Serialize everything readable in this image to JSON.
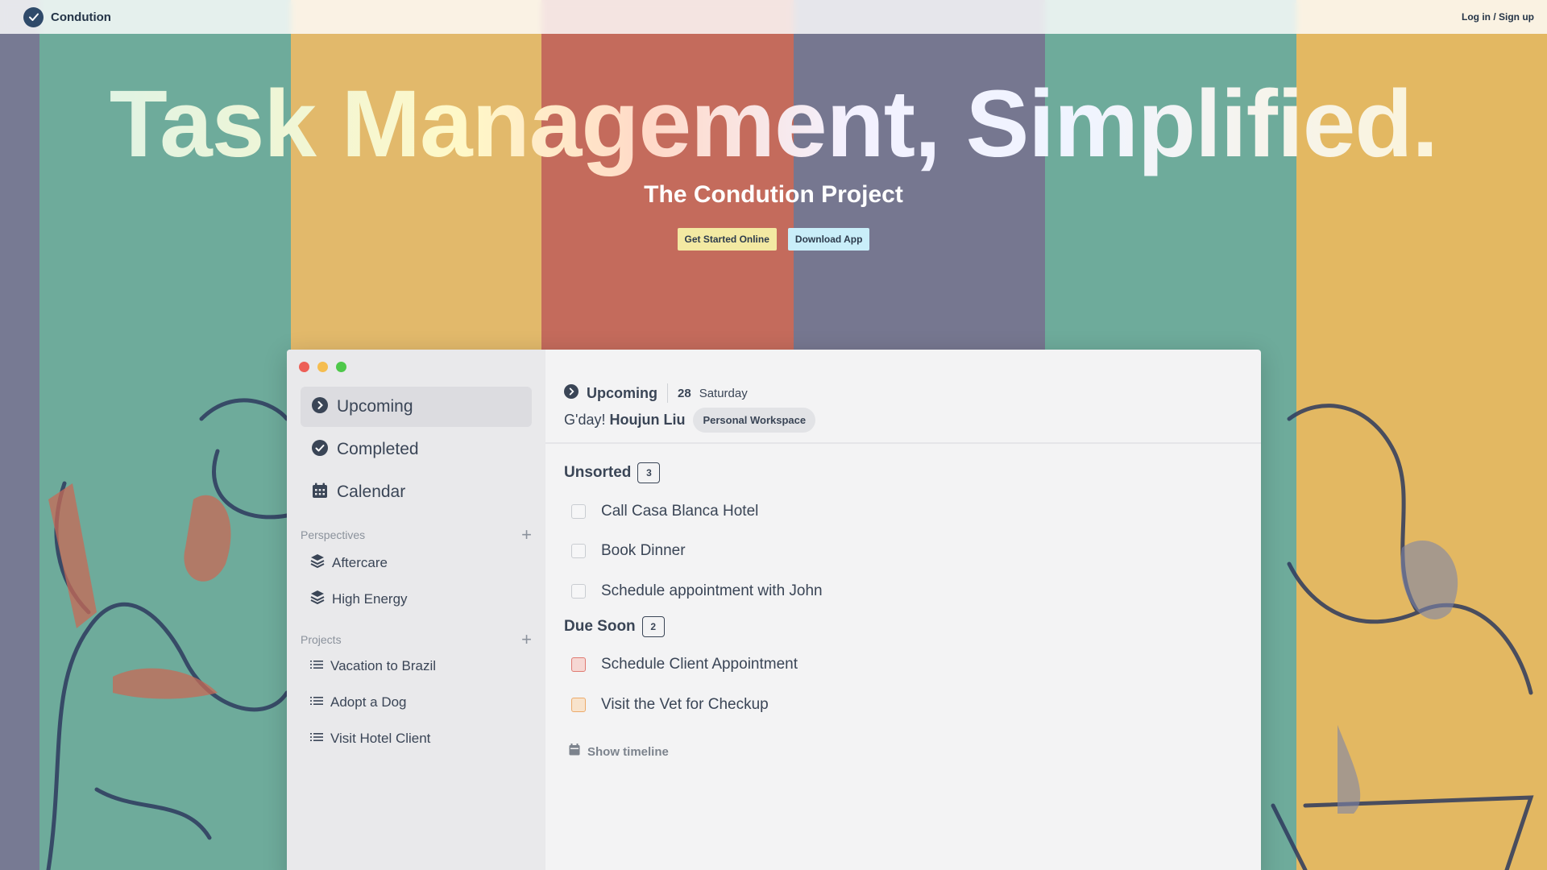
{
  "nav": {
    "brand": "Condution",
    "login": "Log in / Sign up"
  },
  "hero": {
    "title": "Task Management, Simplified.",
    "subtitle": "The Condution Project",
    "primary_button": "Get Started Online",
    "secondary_button": "Download App"
  },
  "colors": {
    "stripes": [
      "#777a93",
      "#6eab9b",
      "#e2b96b",
      "#c46b5c",
      "#767790",
      "#6eab9b",
      "#e3b862"
    ],
    "traffic": [
      "#ed5f57",
      "#f5bd4f",
      "#4ec84a"
    ]
  },
  "sidebar": {
    "items": [
      {
        "label": "Upcoming",
        "icon": "chevron-circle-icon",
        "active": true
      },
      {
        "label": "Completed",
        "icon": "check-circle-icon",
        "active": false
      },
      {
        "label": "Calendar",
        "icon": "calendar-icon",
        "active": false
      }
    ],
    "perspectives_title": "Perspectives",
    "perspectives": [
      {
        "label": "Aftercare",
        "icon": "layers-icon"
      },
      {
        "label": "High Energy",
        "icon": "layers-icon"
      }
    ],
    "projects_title": "Projects",
    "projects": [
      {
        "label": "Vacation to Brazil",
        "icon": "list-icon"
      },
      {
        "label": "Adopt a Dog",
        "icon": "list-icon"
      },
      {
        "label": "Visit Hotel Client",
        "icon": "list-icon"
      }
    ]
  },
  "main": {
    "title": "Upcoming",
    "day_number": "28",
    "day_name": "Saturday",
    "greeting": "G'day!",
    "user_name": "Houjun Liu",
    "workspace": "Personal Workspace",
    "groups": [
      {
        "title": "Unsorted",
        "count": "3",
        "tasks": [
          "Call Casa Blanca Hotel",
          "Book Dinner",
          "Schedule appointment with John"
        ]
      },
      {
        "title": "Due Soon",
        "count": "2",
        "tasks": [
          "Schedule Client Appointment",
          "Visit the Vet for Checkup"
        ]
      }
    ],
    "timeline_label": "Show timeline"
  }
}
